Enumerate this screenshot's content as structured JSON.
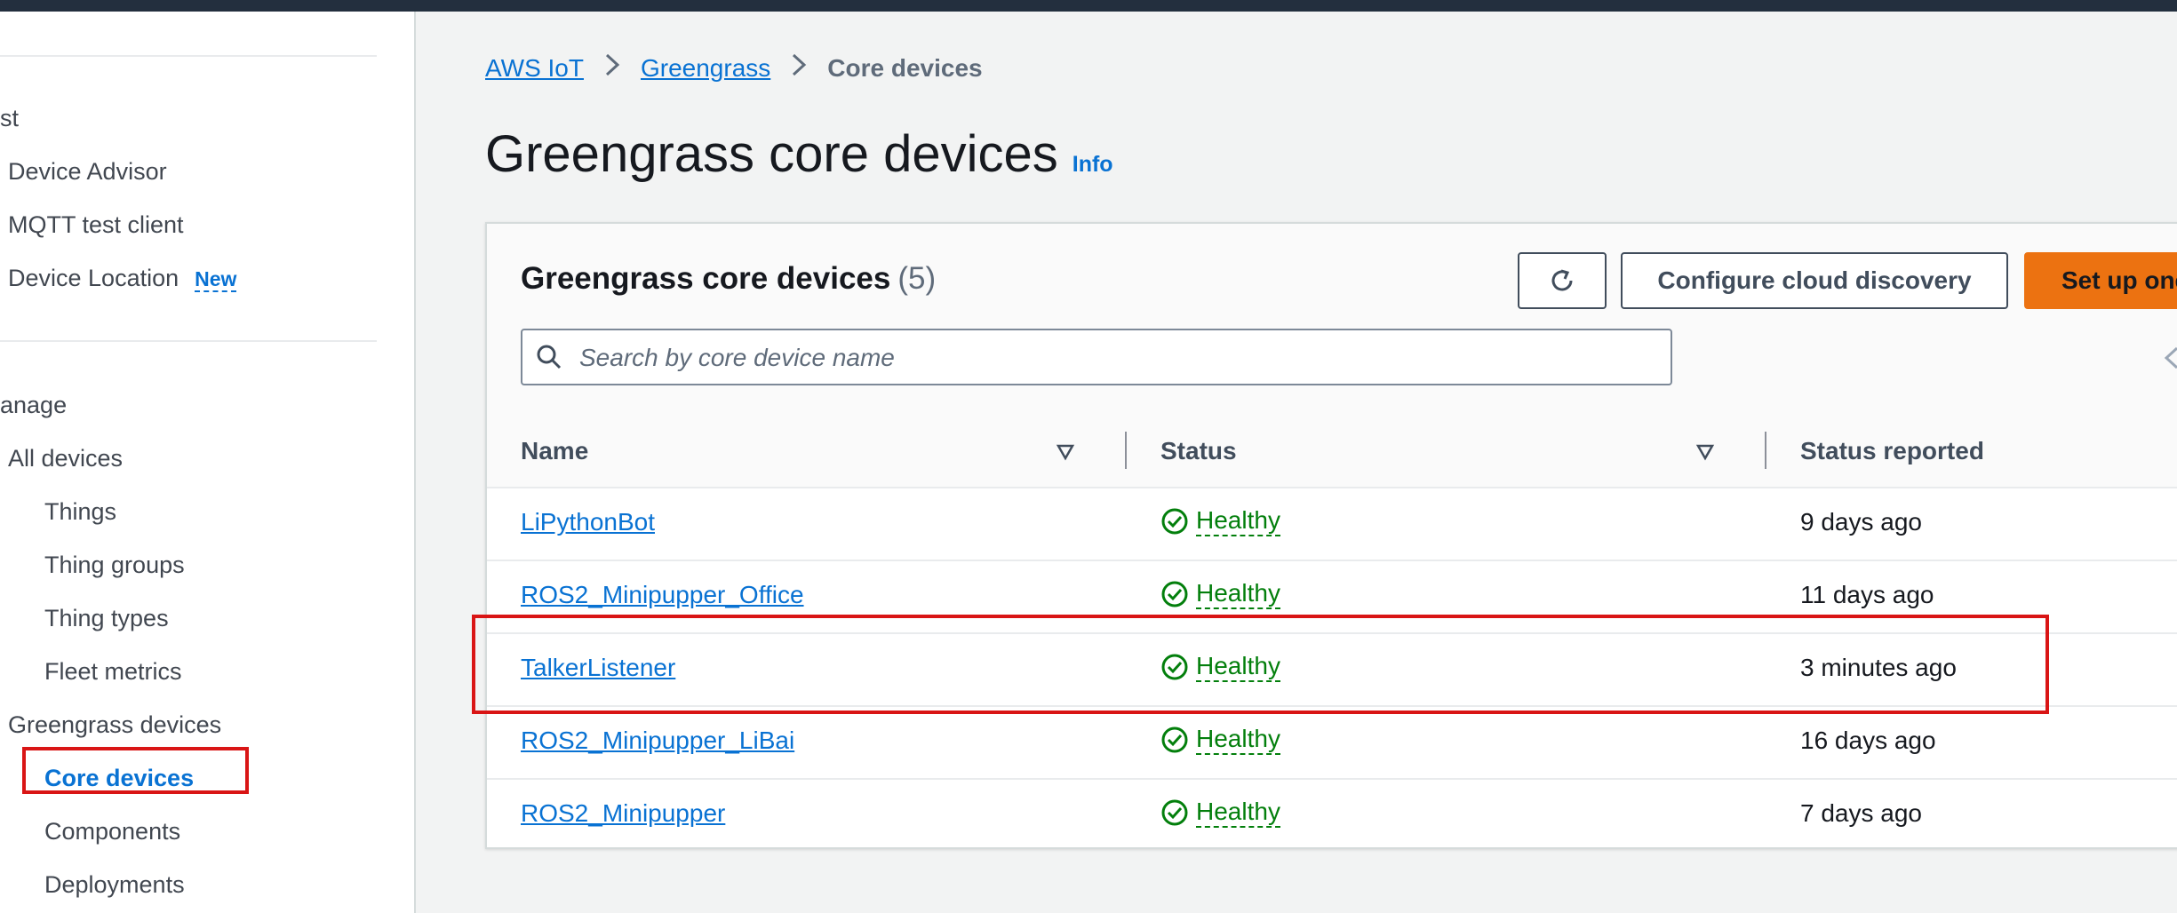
{
  "sidebar": {
    "test_section": "st",
    "test_items": [
      "Device Advisor",
      "MQTT test client",
      "Device Location"
    ],
    "new_badge": "New",
    "manage_section": "anage",
    "all_devices": "All devices",
    "device_items": [
      "Things",
      "Thing groups",
      "Thing types",
      "Fleet metrics"
    ],
    "greengrass_devices": "Greengrass devices",
    "greengrass_items": [
      "Core devices",
      "Components",
      "Deployments"
    ]
  },
  "breadcrumb": {
    "items": [
      "AWS IoT",
      "Greengrass"
    ],
    "current": "Core devices"
  },
  "page": {
    "title": "Greengrass core devices",
    "info": "Info"
  },
  "panel": {
    "title": "Greengrass core devices",
    "count": "(5)",
    "configure_button": "Configure cloud discovery",
    "setup_button": "Set up one",
    "search_placeholder": "Search by core device name"
  },
  "table": {
    "columns": [
      "Name",
      "Status",
      "Status reported"
    ],
    "rows": [
      {
        "name": "LiPythonBot",
        "status": "Healthy",
        "reported": "9 days ago"
      },
      {
        "name": "ROS2_Minipupper_Office",
        "status": "Healthy",
        "reported": "11 days ago"
      },
      {
        "name": "TalkerListener",
        "status": "Healthy",
        "reported": "3 minutes ago"
      },
      {
        "name": "ROS2_Minipupper_LiBai",
        "status": "Healthy",
        "reported": "16 days ago"
      },
      {
        "name": "ROS2_Minipupper",
        "status": "Healthy",
        "reported": "7 days ago"
      }
    ]
  },
  "colors": {
    "link": "#0972d3",
    "healthy": "#037f0c",
    "primary_button": "#ec7211",
    "highlight": "#d91515"
  },
  "icons": [
    "refresh-icon",
    "search-icon",
    "sort-icon",
    "status-healthy-icon",
    "chevron-right-icon"
  ]
}
